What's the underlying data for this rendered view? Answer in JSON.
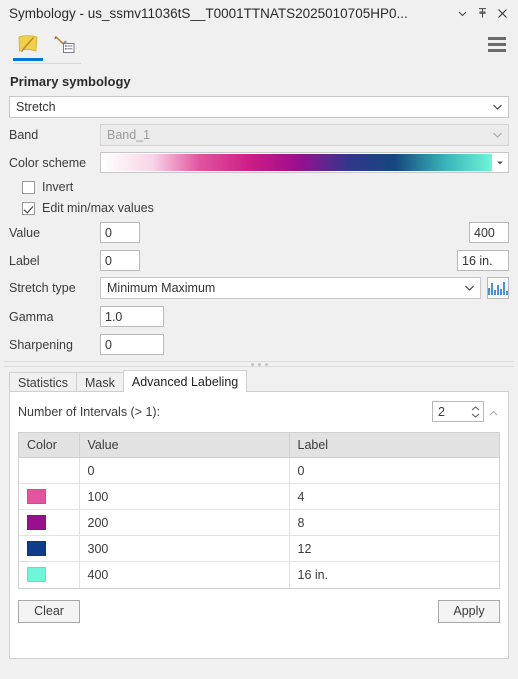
{
  "window": {
    "title": "Symbology - us_ssmv11036tS__T0001TTNATS2025010705HP0...",
    "menu_btn": "▼",
    "pin_btn": "⚑",
    "close_btn": "✕"
  },
  "tabstrip": {
    "gallery_tab": "symbol-gallery",
    "properties_tab": "symbol-properties",
    "menu": "panel-menu"
  },
  "primary": {
    "heading": "Primary symbology",
    "type_value": "Stretch",
    "band_label": "Band",
    "band_value": "Band_1",
    "color_scheme_label": "Color scheme",
    "invert_label": "Invert",
    "invert_checked": false,
    "edit_minmax_label": "Edit min/max values",
    "edit_minmax_checked": true,
    "value_label": "Value",
    "value_min": "0",
    "value_max": "400",
    "label_label": "Label",
    "label_min": "0",
    "label_max": "16 in.",
    "stretch_type_label": "Stretch type",
    "stretch_type_value": "Minimum Maximum",
    "gamma_label": "Gamma",
    "gamma_value": "1.0",
    "sharpening_label": "Sharpening",
    "sharpening_value": "0",
    "ramp_stops": [
      "#ffffff",
      "#f8d4e8",
      "#e2549f",
      "#cd1c86",
      "#9c0f8e",
      "#33368a",
      "#15477f",
      "#39b4b9",
      "#6ff5d8"
    ]
  },
  "lower_tabs": [
    {
      "label": "Statistics",
      "active": false
    },
    {
      "label": "Mask",
      "active": false
    },
    {
      "label": "Advanced Labeling",
      "active": true
    }
  ],
  "advanced_labeling": {
    "intervals_label": "Number of Intervals (> 1):",
    "intervals_value": "2",
    "columns": [
      "Color",
      "Value",
      "Label"
    ],
    "rows": [
      {
        "color": "",
        "value": "0",
        "label": "0"
      },
      {
        "color": "#e2549f",
        "value": "100",
        "label": "4"
      },
      {
        "color": "#99108e",
        "value": "200",
        "label": "8"
      },
      {
        "color": "#0f3d8c",
        "value": "300",
        "label": "12"
      },
      {
        "color": "#6ff5d8",
        "value": "400",
        "label": "16 in."
      }
    ],
    "clear_label": "Clear",
    "apply_label": "Apply"
  }
}
